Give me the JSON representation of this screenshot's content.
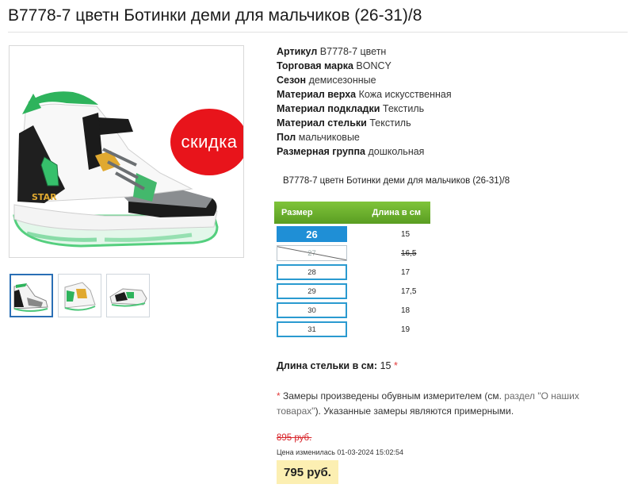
{
  "product": {
    "title": "B7778-7 цветн Ботинки деми для мальчиков (26-31)/8",
    "subtitle": "B7778-7 цветн Ботинки деми для мальчиков (26-31)/8",
    "sale_badge": "скидка"
  },
  "specs": [
    {
      "key": "Артикул",
      "value": "B7778-7 цветн"
    },
    {
      "key": "Торговая марка",
      "value": "BONCY"
    },
    {
      "key": "Сезон",
      "value": "демисезонные"
    },
    {
      "key": "Материал верха",
      "value": "Кожа искусственная"
    },
    {
      "key": "Материал подкладки",
      "value": "Текстиль"
    },
    {
      "key": "Материал стельки",
      "value": "Текстиль"
    },
    {
      "key": "Пол",
      "value": "мальчиковые"
    },
    {
      "key": "Размерная группа",
      "value": "дошкольная"
    }
  ],
  "size_table": {
    "header_size": "Размер",
    "header_length": "Длина в см",
    "rows": [
      {
        "size": "26",
        "length": "15"
      },
      {
        "size": "27",
        "length": "16,5"
      },
      {
        "size": "28",
        "length": "17"
      },
      {
        "size": "29",
        "length": "17,5"
      },
      {
        "size": "30",
        "length": "18"
      },
      {
        "size": "31",
        "length": "19"
      }
    ]
  },
  "insole": {
    "label": "Длина стельки в см:",
    "value": "15",
    "asterisk": "*"
  },
  "note": {
    "asterisk": "*",
    "text_before": " Замеры произведены обувным измерителем (см. ",
    "link": "раздел \"О наших товарах\"",
    "text_after": "). Указанные замеры являются примерными."
  },
  "price": {
    "old": "895 руб.",
    "changed": "Цена изменилась 01-03-2024 15:02:54",
    "current": "795 руб."
  },
  "colors": {
    "accent_green": "#6cb52e",
    "size_blue": "#1f8fd6",
    "sale_red": "#e8141b",
    "price_bg": "#fcefb2"
  }
}
